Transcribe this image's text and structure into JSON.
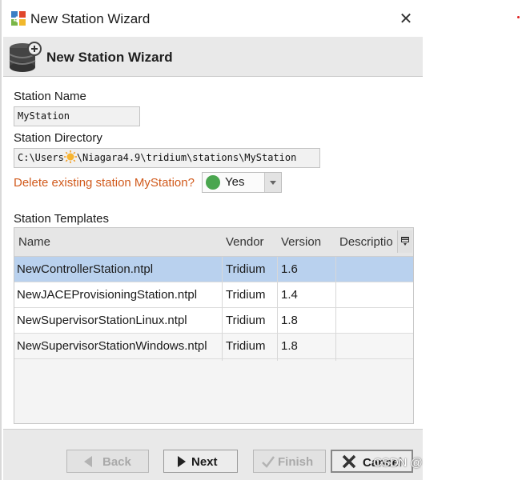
{
  "window": {
    "title": "New Station Wizard",
    "close_glyph": "✕"
  },
  "header": {
    "title": "New Station Wizard",
    "icon": "database-add-icon"
  },
  "form": {
    "station_name_label": "Station Name",
    "station_name_value": "MyStation",
    "station_dir_label": "Station Directory",
    "station_dir_prefix": "C:\\Users",
    "station_dir_suffix": "\\Niagara4.9\\tridium\\stations\\MyStation",
    "delete_label": "Delete existing station MyStation?",
    "delete_value": "Yes",
    "delete_status_color": "#4aa64f"
  },
  "templates": {
    "label": "Station Templates",
    "columns": [
      "Name",
      "Vendor",
      "Version",
      "Descriptio"
    ],
    "rows": [
      {
        "name": "NewControllerStation.ntpl",
        "vendor": "Tridium",
        "version": "1.6",
        "description": ""
      },
      {
        "name": "NewJACEProvisioningStation.ntpl",
        "vendor": "Tridium",
        "version": "1.4",
        "description": ""
      },
      {
        "name": "NewSupervisorStationLinux.ntpl",
        "vendor": "Tridium",
        "version": "1.8",
        "description": ""
      },
      {
        "name": "NewSupervisorStationWindows.ntpl",
        "vendor": "Tridium",
        "version": "1.8",
        "description": ""
      }
    ],
    "selected_index": 0
  },
  "footer": {
    "back": "Back",
    "next": "Next",
    "finish": "Finish",
    "cancel": "Cancel"
  },
  "watermark": "CSDN @",
  "colors": {
    "selection": "#b9d1ee",
    "warning_text": "#d15a1c"
  }
}
